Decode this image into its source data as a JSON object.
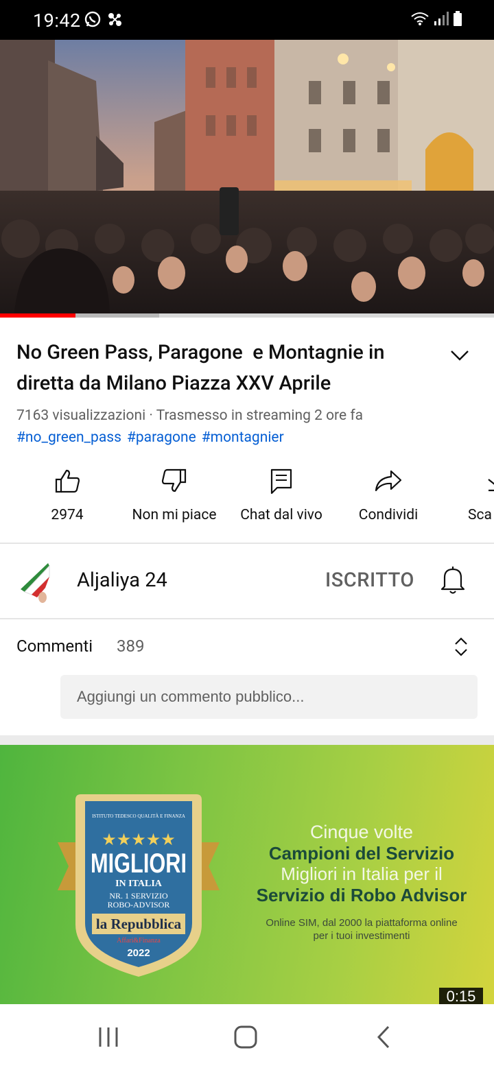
{
  "status_bar": {
    "time": "19:42",
    "icons_left": [
      "whatsapp-icon",
      "app-icon"
    ],
    "icons_right": [
      "wifi-icon",
      "signal-icon",
      "battery-icon"
    ]
  },
  "video": {
    "description_colors": {
      "sky": "#c89a86",
      "crowd": "#2a2222"
    },
    "progress_played_fraction": 0.153,
    "progress_buffered_fraction": 0.322
  },
  "title": "No Green Pass, Paragone  e Montagnie in\ndiretta da Milano Piazza XXV Aprile",
  "meta": "7163 visualizzazioni · Trasmesso in streaming 2 ore fa",
  "hashtags": [
    "#no_green_pass",
    "#paragone",
    "#montagnier"
  ],
  "actions": [
    {
      "icon": "like-icon",
      "label": "2974"
    },
    {
      "icon": "dislike-icon",
      "label": "Non mi piace"
    },
    {
      "icon": "chat-icon",
      "label": "Chat dal vivo"
    },
    {
      "icon": "share-icon",
      "label": "Condividi"
    },
    {
      "icon": "download-icon",
      "label": "Sca"
    }
  ],
  "channel": {
    "name": "Aljaliya 24",
    "subscribe_label": "ISCRITTO"
  },
  "comments": {
    "label": "Commenti",
    "count": "389",
    "placeholder": "Aggiungi un commento pubblico..."
  },
  "ad": {
    "badge": {
      "top_text": "ISTITUTO TEDESCO QUALITÀ E FINANZA",
      "stars": "★★★★★",
      "headline": "MIGLIORI",
      "subline": "IN ITALIA",
      "service1": "NR. 1 SERVIZIO",
      "service2": "ROBO-ADVISOR",
      "brand": "la Repubblica",
      "brand_sub": "Affari&Finanza",
      "year": "2022"
    },
    "lines": [
      "Cinque volte",
      "Campioni del Servizio",
      "Migliori in Italia per il",
      "Servizio di Robo Advisor"
    ],
    "small_text_1": "Online SIM, dal 2000 la piattaforma online",
    "small_text_2": "per i tuoi investimenti",
    "duration": "0:15"
  },
  "colors": {
    "accent_red": "#ff0000",
    "link_blue": "#065fd4",
    "secondary_text": "#606060"
  }
}
